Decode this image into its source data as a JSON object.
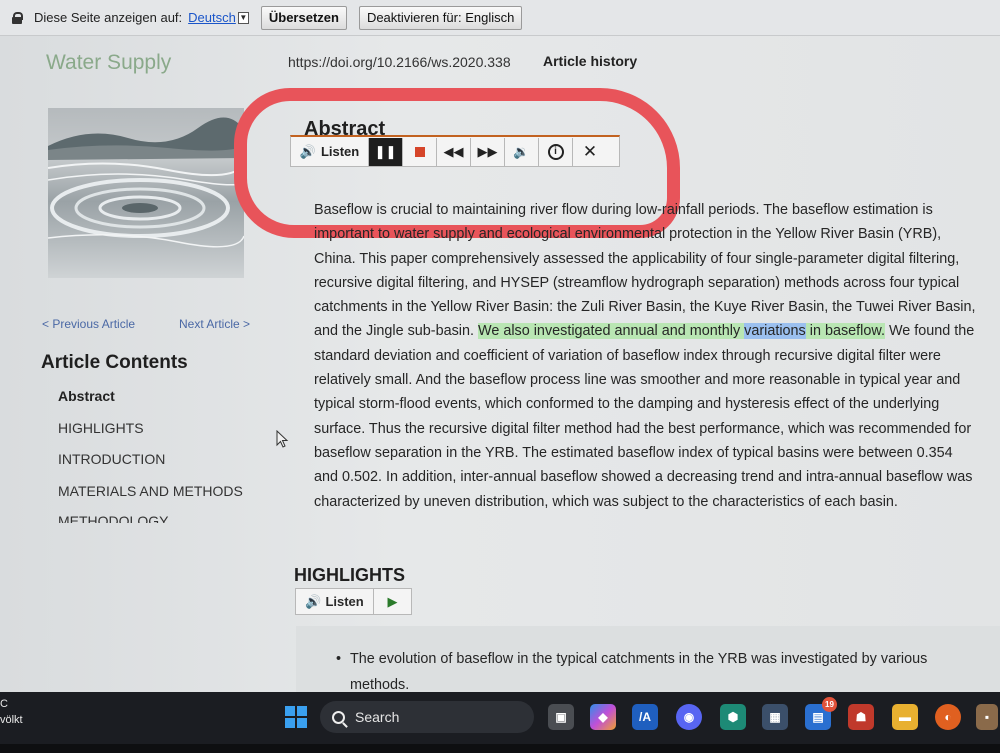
{
  "translate_bar": {
    "prompt": "Diese Seite anzeigen auf:",
    "language": "Deutsch",
    "translate_button": "Übersetzen",
    "disable_button": "Deaktivieren für: Englisch"
  },
  "header": {
    "journal": "Water Supply",
    "doi": "https://doi.org/10.2166/ws.2020.338",
    "history": "Article history"
  },
  "sidebar": {
    "prev": "< Previous Article",
    "next": "Next Article >",
    "contents_title": "Article Contents",
    "items": [
      {
        "label": "Abstract"
      },
      {
        "label": "HIGHLIGHTS"
      },
      {
        "label": "INTRODUCTION"
      },
      {
        "label": "MATERIALS AND METHODS"
      },
      {
        "label": "METHODOLOGY"
      }
    ]
  },
  "abstract": {
    "heading": "Abstract",
    "listen": "Listen",
    "text_before": "Baseflow is crucial to maintaining river flow during low-rainfall periods. The baseflow estimation is important to water supply and ecological environmental protection in the Yellow River Basin (YRB), China. This paper comprehensively assessed the applicability of four single-parameter digital filtering, recursive digital filtering, and HYSEP (streamflow hydrograph separation) methods across four typical catchments in the Yellow River Basin: the Zuli River Basin, the Kuye River Basin, the Tuwei River Basin, and the Jingle sub-basin. ",
    "highlight_a": "We also investigated annual and monthly ",
    "highlight_word": "variations",
    "highlight_b": " in baseflow.",
    "text_after": " We found the standard deviation and coefficient of variation of baseflow index through recursive digital filter were relatively small. And the baseflow process line was smoother and more reasonable in typical year and typical storm-flood events, which conformed to the damping and hysteresis effect of the underlying surface. Thus the recursive digital filter method had the best performance, which was recommended for baseflow separation in the YRB. The estimated baseflow index of typical basins were between 0.354 and 0.502. In addition, inter-annual baseflow showed a decreasing trend and intra-annual baseflow was characterized by uneven distribution, which was subject to the characteristics of each basin."
  },
  "highlights": {
    "heading": "HIGHLIGHTS",
    "listen": "Listen",
    "items": [
      "The evolution of baseflow in the typical catchments in the YRB was investigated by various methods."
    ]
  },
  "taskbar": {
    "left_line1": "C",
    "left_line2": "völkt",
    "search": "Search",
    "badge": "19"
  },
  "colors": {
    "accent_orange": "#c26220",
    "annotation_red": "#e8545a",
    "highlight_green": "#b9e6b3",
    "highlight_blue": "#9bc0ef"
  }
}
